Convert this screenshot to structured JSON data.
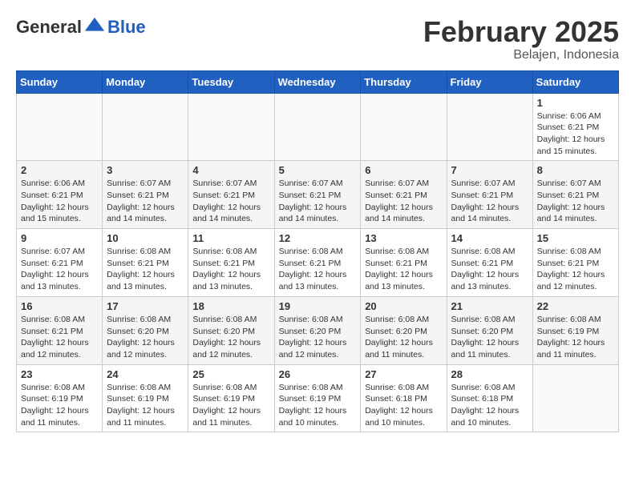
{
  "header": {
    "logo_general": "General",
    "logo_blue": "Blue",
    "month": "February 2025",
    "location": "Belajen, Indonesia"
  },
  "weekdays": [
    "Sunday",
    "Monday",
    "Tuesday",
    "Wednesday",
    "Thursday",
    "Friday",
    "Saturday"
  ],
  "weeks": [
    [
      {
        "day": "",
        "info": ""
      },
      {
        "day": "",
        "info": ""
      },
      {
        "day": "",
        "info": ""
      },
      {
        "day": "",
        "info": ""
      },
      {
        "day": "",
        "info": ""
      },
      {
        "day": "",
        "info": ""
      },
      {
        "day": "1",
        "info": "Sunrise: 6:06 AM\nSunset: 6:21 PM\nDaylight: 12 hours\nand 15 minutes."
      }
    ],
    [
      {
        "day": "2",
        "info": "Sunrise: 6:06 AM\nSunset: 6:21 PM\nDaylight: 12 hours\nand 15 minutes."
      },
      {
        "day": "3",
        "info": "Sunrise: 6:07 AM\nSunset: 6:21 PM\nDaylight: 12 hours\nand 14 minutes."
      },
      {
        "day": "4",
        "info": "Sunrise: 6:07 AM\nSunset: 6:21 PM\nDaylight: 12 hours\nand 14 minutes."
      },
      {
        "day": "5",
        "info": "Sunrise: 6:07 AM\nSunset: 6:21 PM\nDaylight: 12 hours\nand 14 minutes."
      },
      {
        "day": "6",
        "info": "Sunrise: 6:07 AM\nSunset: 6:21 PM\nDaylight: 12 hours\nand 14 minutes."
      },
      {
        "day": "7",
        "info": "Sunrise: 6:07 AM\nSunset: 6:21 PM\nDaylight: 12 hours\nand 14 minutes."
      },
      {
        "day": "8",
        "info": "Sunrise: 6:07 AM\nSunset: 6:21 PM\nDaylight: 12 hours\nand 14 minutes."
      }
    ],
    [
      {
        "day": "9",
        "info": "Sunrise: 6:07 AM\nSunset: 6:21 PM\nDaylight: 12 hours\nand 13 minutes."
      },
      {
        "day": "10",
        "info": "Sunrise: 6:08 AM\nSunset: 6:21 PM\nDaylight: 12 hours\nand 13 minutes."
      },
      {
        "day": "11",
        "info": "Sunrise: 6:08 AM\nSunset: 6:21 PM\nDaylight: 12 hours\nand 13 minutes."
      },
      {
        "day": "12",
        "info": "Sunrise: 6:08 AM\nSunset: 6:21 PM\nDaylight: 12 hours\nand 13 minutes."
      },
      {
        "day": "13",
        "info": "Sunrise: 6:08 AM\nSunset: 6:21 PM\nDaylight: 12 hours\nand 13 minutes."
      },
      {
        "day": "14",
        "info": "Sunrise: 6:08 AM\nSunset: 6:21 PM\nDaylight: 12 hours\nand 13 minutes."
      },
      {
        "day": "15",
        "info": "Sunrise: 6:08 AM\nSunset: 6:21 PM\nDaylight: 12 hours\nand 12 minutes."
      }
    ],
    [
      {
        "day": "16",
        "info": "Sunrise: 6:08 AM\nSunset: 6:21 PM\nDaylight: 12 hours\nand 12 minutes."
      },
      {
        "day": "17",
        "info": "Sunrise: 6:08 AM\nSunset: 6:20 PM\nDaylight: 12 hours\nand 12 minutes."
      },
      {
        "day": "18",
        "info": "Sunrise: 6:08 AM\nSunset: 6:20 PM\nDaylight: 12 hours\nand 12 minutes."
      },
      {
        "day": "19",
        "info": "Sunrise: 6:08 AM\nSunset: 6:20 PM\nDaylight: 12 hours\nand 12 minutes."
      },
      {
        "day": "20",
        "info": "Sunrise: 6:08 AM\nSunset: 6:20 PM\nDaylight: 12 hours\nand 11 minutes."
      },
      {
        "day": "21",
        "info": "Sunrise: 6:08 AM\nSunset: 6:20 PM\nDaylight: 12 hours\nand 11 minutes."
      },
      {
        "day": "22",
        "info": "Sunrise: 6:08 AM\nSunset: 6:19 PM\nDaylight: 12 hours\nand 11 minutes."
      }
    ],
    [
      {
        "day": "23",
        "info": "Sunrise: 6:08 AM\nSunset: 6:19 PM\nDaylight: 12 hours\nand 11 minutes."
      },
      {
        "day": "24",
        "info": "Sunrise: 6:08 AM\nSunset: 6:19 PM\nDaylight: 12 hours\nand 11 minutes."
      },
      {
        "day": "25",
        "info": "Sunrise: 6:08 AM\nSunset: 6:19 PM\nDaylight: 12 hours\nand 11 minutes."
      },
      {
        "day": "26",
        "info": "Sunrise: 6:08 AM\nSunset: 6:19 PM\nDaylight: 12 hours\nand 10 minutes."
      },
      {
        "day": "27",
        "info": "Sunrise: 6:08 AM\nSunset: 6:18 PM\nDaylight: 12 hours\nand 10 minutes."
      },
      {
        "day": "28",
        "info": "Sunrise: 6:08 AM\nSunset: 6:18 PM\nDaylight: 12 hours\nand 10 minutes."
      },
      {
        "day": "",
        "info": ""
      }
    ]
  ]
}
